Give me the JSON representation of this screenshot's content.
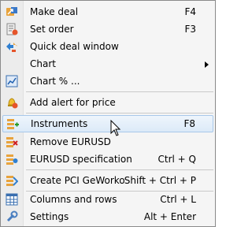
{
  "menu": {
    "items": [
      {
        "label": "Make deal",
        "shortcut": "F4",
        "icon": "make-deal-icon"
      },
      {
        "label": "Set order",
        "shortcut": "F3",
        "icon": "set-order-icon"
      },
      {
        "label": "Quick deal window",
        "shortcut": "",
        "icon": "quick-deal-icon"
      },
      {
        "label": "Chart",
        "shortcut": "",
        "icon": ""
      },
      {
        "label": "Chart % ...",
        "shortcut": "",
        "icon": "chart-percent-icon"
      },
      {
        "label": "Add alert for price",
        "shortcut": "",
        "icon": "alert-icon"
      },
      {
        "label": "Instruments",
        "shortcut": "F8",
        "icon": "instruments-icon"
      },
      {
        "label": "Remove EURUSD",
        "shortcut": "",
        "icon": "remove-icon"
      },
      {
        "label": "EURUSD specification",
        "shortcut": "Ctrl + Q",
        "icon": "specification-icon"
      },
      {
        "label": "Create PCI GeWorko",
        "shortcut": "Shift + Ctrl + P",
        "icon": "pci-icon"
      },
      {
        "label": "Columns and rows",
        "shortcut": "Ctrl + L",
        "icon": "columns-icon"
      },
      {
        "label": "Settings",
        "shortcut": "Alt + Enter",
        "icon": "settings-icon"
      }
    ]
  }
}
